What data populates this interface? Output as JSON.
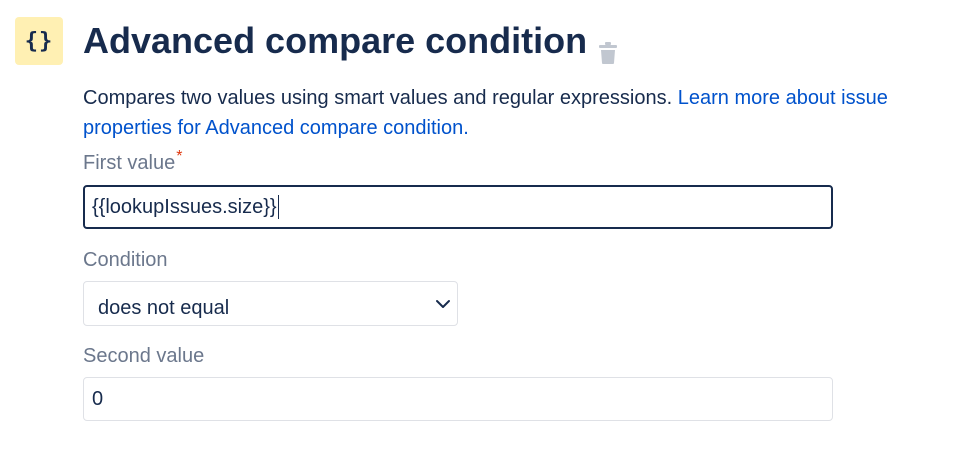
{
  "header": {
    "badge_text": "{}",
    "title": "Advanced compare condition",
    "delete_icon": "trash-icon"
  },
  "description": {
    "text": "Compares two values using smart values and regular expressions. ",
    "link_text": "Learn more about issue properties for Advanced compare condition."
  },
  "first_value": {
    "label": "First value",
    "required_marker": "*",
    "value": "{{lookupIssues.size}}"
  },
  "condition": {
    "label": "Condition",
    "selected": "does not equal",
    "icon": "chevron-down-icon"
  },
  "second_value": {
    "label": "Second value",
    "value": "0"
  },
  "colors": {
    "badge_bg": "#fff0b3",
    "text_primary": "#172b4d",
    "text_muted": "#6b778c",
    "link": "#0052cc",
    "required": "#de350b",
    "border": "#dfe1e6"
  }
}
